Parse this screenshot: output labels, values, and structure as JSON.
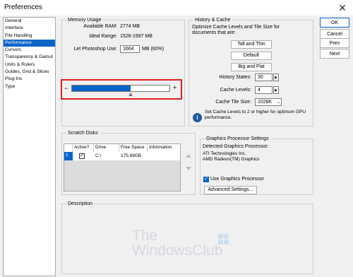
{
  "window": {
    "title": "Preferences",
    "close_glyph": "✕"
  },
  "sidebar": {
    "items": [
      {
        "label": "General"
      },
      {
        "label": "Interface"
      },
      {
        "label": "File Handling"
      },
      {
        "label": "Performance",
        "selected": true
      },
      {
        "label": "Cursors"
      },
      {
        "label": "Transparency & Gamut"
      },
      {
        "label": "Units & Rulers"
      },
      {
        "label": "Guides, Grid & Slices"
      },
      {
        "label": "Plug-Ins"
      },
      {
        "label": "Type"
      }
    ]
  },
  "memory": {
    "legend": "Memory Usage",
    "available_label": "Available RAM:",
    "available_value": "2774 MB",
    "ideal_label": "Ideal Range:",
    "ideal_value": "1526-1997 MB",
    "let_label": "Let Photoshop Use:",
    "let_value": "1664",
    "let_suffix": "MB (60%)",
    "slider_fraction": 0.6,
    "minus": "−",
    "plus": "+"
  },
  "history": {
    "legend": "History & Cache",
    "intro": "Optimize Cache Levels and Tile Size for documents that are:",
    "buttons": [
      "Tall and Thin",
      "Default",
      "Big and Flat"
    ],
    "states_label": "History States:",
    "states_value": "30",
    "levels_label": "Cache Levels:",
    "levels_value": "4",
    "tile_label": "Cache Tile Size:",
    "tile_value": "1028K",
    "info_text": "Set Cache Levels to 2 or higher for optimum GPU performance.",
    "info_icon": "i"
  },
  "scratch": {
    "legend": "Scratch Disks",
    "columns": [
      "Active?",
      "Drive",
      "Free Space",
      "Information"
    ],
    "rows": [
      {
        "num": "1",
        "active": "✓",
        "drive": "C:\\",
        "free": "175.69GB",
        "info": ""
      }
    ]
  },
  "gpu": {
    "legend": "Graphics Processor Settings",
    "detected_label": "Detected Graphics Processor:",
    "vendor": "ATI Technologies Inc.",
    "model": "AMD Radeon(TM) Graphics",
    "use_label": "Use Graphics Processor",
    "use_checked": "✓",
    "advanced_label": "Advanced Settings..."
  },
  "description": {
    "legend": "Description"
  },
  "actions": {
    "ok": "OK",
    "cancel": "Cancel",
    "prev": "Prev",
    "next": "Next"
  },
  "watermark": {
    "line1": "The",
    "line2": "WindowsClub"
  },
  "colors": {
    "accent": "#0a64c8",
    "highlight_box": "#e02020",
    "watermark": "#d8d8e2"
  }
}
